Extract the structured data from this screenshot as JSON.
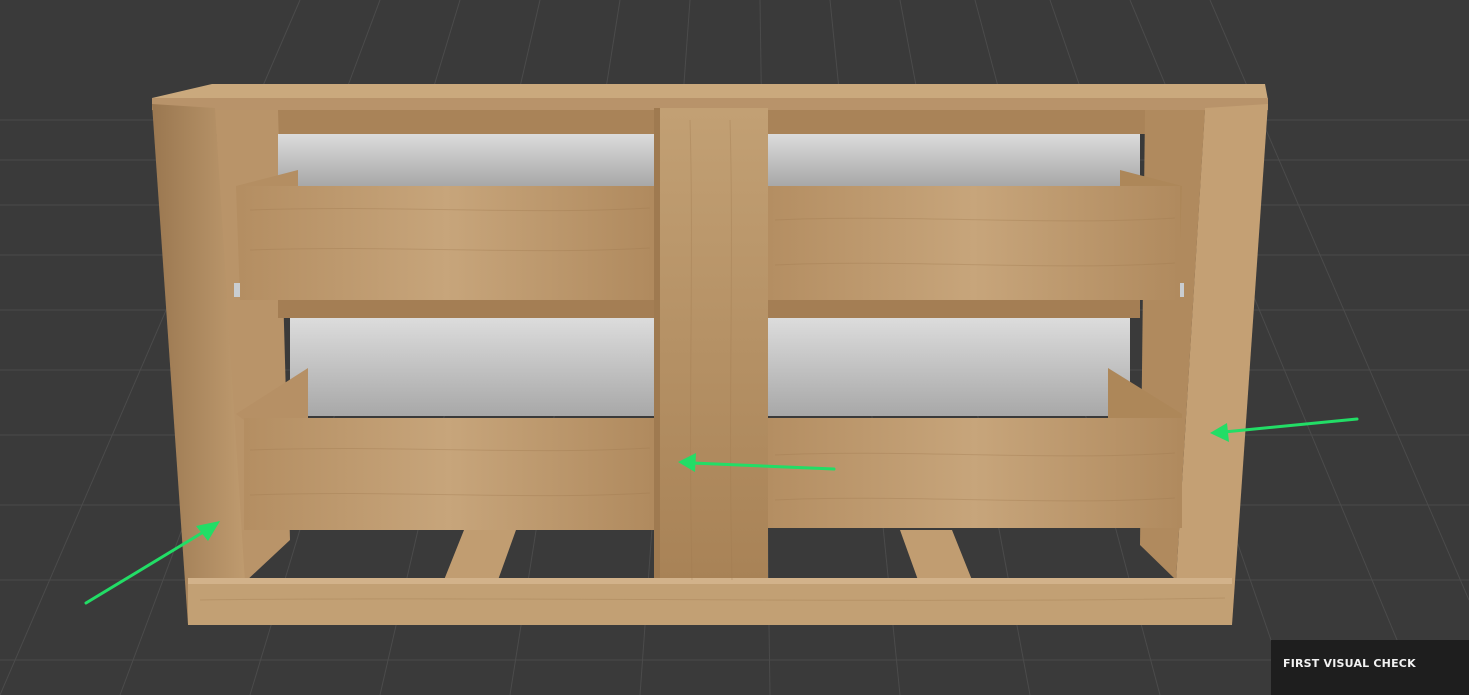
{
  "viewport": {
    "background": "#3a3a3a",
    "grid_color": "#4a4a4a",
    "wood_light": "#c8a67c",
    "wood_mid": "#b08a5e",
    "wood_dark": "#8d6a44",
    "drawer_interior": "#bdbdbd",
    "arrow_color": "#22dd66"
  },
  "status_panel": {
    "label": "FIRST VISUAL CHECK"
  }
}
